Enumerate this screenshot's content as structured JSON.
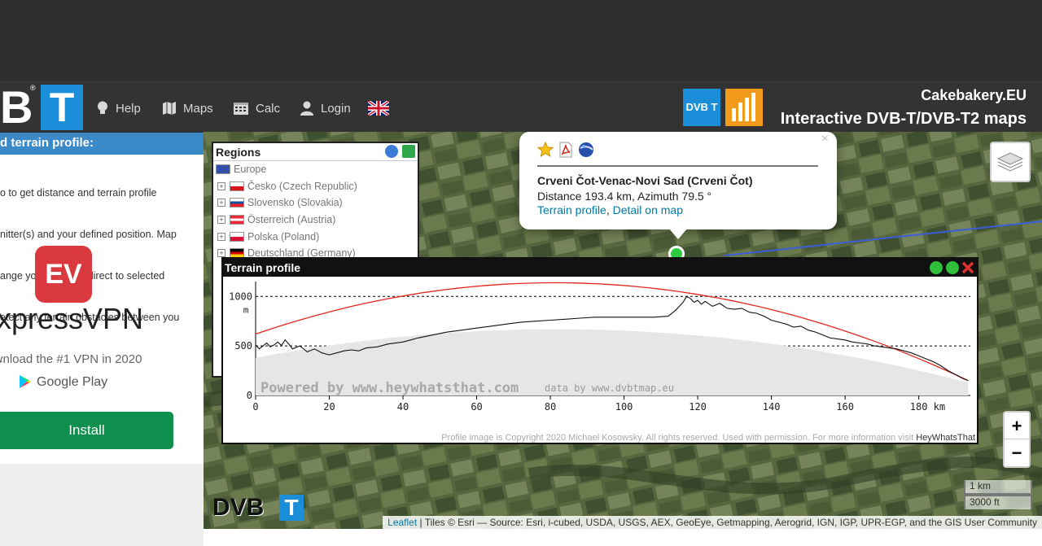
{
  "navbar": {
    "logo_left": {
      "b": "B",
      "t": "T",
      "reg": "®"
    },
    "items": [
      {
        "label": "Help",
        "icon": "lightbulb-icon"
      },
      {
        "label": "Maps",
        "icon": "map-icon"
      },
      {
        "label": "Calc",
        "icon": "calendar-icon"
      },
      {
        "label": "Login",
        "icon": "user-icon"
      }
    ],
    "language_icon": "uk-flag-icon",
    "brand_logo_text": "DVB T",
    "site_name": "Cakebakery.EU",
    "subtitle": "Interactive DVB-T/DVB-T2 maps"
  },
  "sidebar": {
    "heading": "d terrain profile:",
    "text_lines": [
      "o to get distance and terrain profile",
      "nitter(s) and your defined position. Map",
      "ange your antenna direct to selected",
      "etect any terrain obstacles between you",
      "."
    ],
    "ad": {
      "logo_text": "EV",
      "name": "xpressVPN",
      "tagline": "vnload the #1 VPN in 2020",
      "store": "Google Play",
      "install_label": "Install"
    }
  },
  "regions": {
    "title": "Regions",
    "root": "Europe",
    "items": [
      {
        "label": "Česko (Czech Republic)",
        "flag": [
          "#ffffff",
          "#d7141a"
        ]
      },
      {
        "label": "Slovensko (Slovakia)",
        "flag": [
          "#ffffff",
          "#0b4ea2",
          "#ee1c25"
        ]
      },
      {
        "label": "Österreich (Austria)",
        "flag": [
          "#ed2939",
          "#ffffff",
          "#ed2939"
        ]
      },
      {
        "label": "Polska (Poland)",
        "flag": [
          "#ffffff",
          "#dc143c"
        ]
      },
      {
        "label": "Deutschland (Germany)",
        "flag": [
          "#000000",
          "#dd0000",
          "#ffce00"
        ]
      }
    ]
  },
  "popup": {
    "close": "×",
    "title": "Crveni Čot-Venac-Novi Sad (Crveni Čot)",
    "distance": "Distance 193.4 km, Azimuth 79.5 °",
    "link_terrain": "Terrain profile",
    "separator": ", ",
    "link_detail": "Detail on map"
  },
  "terrain": {
    "title": "Terrain profile",
    "copyright": "Profile image is Copyright 2020 Michael Kosowsky. All rights reserved. Used with permission. For more information visit",
    "copyright_link": "HeyWhatsThat",
    "powered": "Powered by www.heywhatsthat.com",
    "data_by": "data by www.dvbtmap.eu"
  },
  "chart_data": {
    "type": "line",
    "xlabel": "km",
    "ylabel": "m",
    "xlim": [
      0,
      194
    ],
    "ylim": [
      0,
      1150
    ],
    "xticks": [
      0,
      20,
      40,
      60,
      80,
      100,
      120,
      140,
      160,
      180
    ],
    "yticks": [
      0,
      500,
      1000
    ],
    "series": [
      {
        "x": [
          0,
          1,
          2,
          3,
          4,
          5,
          6,
          7,
          8,
          9,
          10,
          12,
          14,
          16,
          18,
          20,
          22,
          24,
          26,
          28,
          30,
          33,
          36,
          40,
          44,
          48,
          52,
          56,
          60,
          64,
          68,
          72,
          76,
          80,
          84,
          88,
          92,
          96,
          100,
          104,
          108,
          112,
          114,
          116,
          117,
          118,
          119,
          120,
          121,
          122,
          124,
          126,
          128,
          130,
          132,
          134,
          136,
          138,
          140,
          142,
          144,
          146,
          148,
          150,
          152,
          154,
          156,
          158,
          160,
          162,
          164,
          166,
          168,
          170,
          172,
          174,
          176,
          178,
          180,
          182,
          184,
          186,
          188,
          190,
          192,
          193.4
        ],
        "values": [
          510,
          470,
          500,
          530,
          490,
          510,
          540,
          505,
          560,
          520,
          470,
          500,
          440,
          470,
          430,
          410,
          430,
          450,
          460,
          450,
          480,
          490,
          520,
          540,
          580,
          610,
          640,
          660,
          680,
          700,
          720,
          740,
          750,
          760,
          770,
          780,
          790,
          790,
          790,
          790,
          790,
          800,
          860,
          940,
          1000,
          980,
          940,
          960,
          920,
          950,
          900,
          930,
          880,
          870,
          880,
          840,
          830,
          800,
          760,
          740,
          720,
          690,
          700,
          660,
          640,
          610,
          580,
          570,
          560,
          540,
          530,
          520,
          500,
          490,
          480,
          470,
          450,
          430,
          400,
          370,
          340,
          300,
          250,
          210,
          170,
          150
        ]
      }
    ]
  },
  "map": {
    "attribution_link": "Leaflet",
    "attribution_text": " | Tiles © Esri — Source: Esri, i-cubed, USDA, USGS, AEX, GeoEye, Getmapping, Aerogrid, IGN, IGP, UPR-EGP, and the GIS User Community",
    "zoom_in": "+",
    "zoom_out": "−",
    "scale_km": "1 km",
    "scale_ft": "3000 ft",
    "logo_dvb": "DVB",
    "logo_t": "T"
  },
  "colors": {
    "navbar": "#333333",
    "accent_blue": "#1a8ed8",
    "sidebar_heading": "#3c89c7",
    "install_green": "#0f8f4d",
    "curvature_red": "#e3261d",
    "link": "#0078a8"
  }
}
